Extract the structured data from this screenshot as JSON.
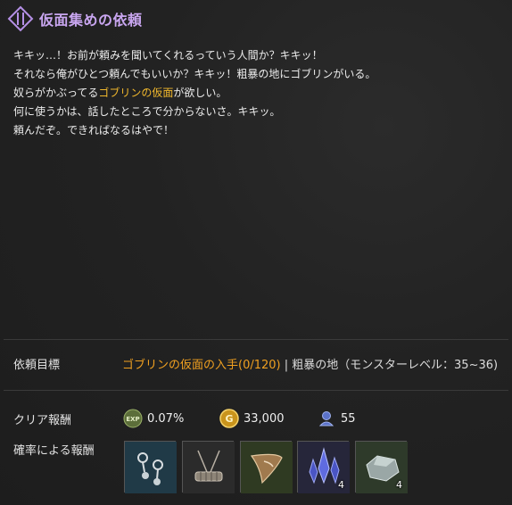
{
  "quest": {
    "title": "仮面集めの依頼",
    "dialog": {
      "line1": "キキッ…！お前が頼みを聞いてくれるっていう人間か？キキッ！",
      "line2": "それなら俺がひとつ頼んでもいいか？キキッ！粗暴の地にゴブリンがいる。",
      "line3_pre": "奴らがかぶってる",
      "line3_item": "ゴブリンの仮面",
      "line3_post": "が欲しい。",
      "line4": "何に使うかは、話したところで分からないさ。キキッ。",
      "line5": "頼んだぞ。できればなるはやで！"
    }
  },
  "objective": {
    "label": "依頼目標",
    "target": "ゴブリンの仮面の入手(0/120)",
    "separator": "|",
    "location": "粗暴の地（モンスターレベル：35~36)"
  },
  "rewards": {
    "label": "クリア報酬",
    "exp": "0.07%",
    "gold": "33,000",
    "contribution": "55"
  },
  "probable_rewards": {
    "label": "確率による報酬",
    "items": [
      {
        "icon": "earring-icon",
        "count": ""
      },
      {
        "icon": "necklace-icon",
        "count": ""
      },
      {
        "icon": "horn-icon",
        "count": ""
      },
      {
        "icon": "crystal-icon",
        "count": "4"
      },
      {
        "icon": "ore-icon",
        "count": "4"
      }
    ]
  },
  "colors": {
    "title": "#c9a6f0",
    "highlight": "#f1b82d",
    "objective": "#f0a020"
  }
}
